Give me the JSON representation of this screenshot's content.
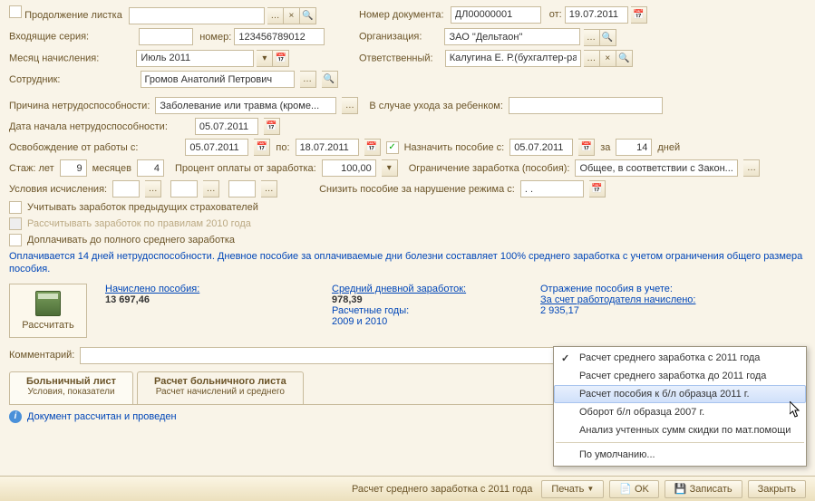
{
  "row1": {
    "cont_label": "Продолжение листка",
    "cont_value": "",
    "doc_num_label": "Номер документа:",
    "doc_num": "ДЛ00000001",
    "from_label": "от:",
    "from_date": "19.07.2011"
  },
  "row2": {
    "series_label": "Входящие серия:",
    "series": "",
    "num_label": "номер:",
    "num": "123456789012",
    "org_label": "Организация:",
    "org": "ЗАО \"Дельтаон\""
  },
  "row3": {
    "month_label": "Месяц начисления:",
    "month": "Июль 2011",
    "resp_label": "Ответственный:",
    "resp": "Калугина Е. Р.(бухгалтер-рас..."
  },
  "row4": {
    "emp_label": "Сотрудник:",
    "emp": "Громов Анатолий Петрович"
  },
  "reason": {
    "label": "Причина нетрудоспособности:",
    "value": "Заболевание или травма (кроме...",
    "child_label": "В случае ухода за ребенком:",
    "child_value": ""
  },
  "start": {
    "label": "Дата начала нетрудоcпособности:",
    "value": "05.07.2011"
  },
  "release": {
    "label": "Освобождение от работы с:",
    "from": "05.07.2011",
    "to_label": "по:",
    "to": "18.07.2011",
    "assign_label": "Назначить пособие с:",
    "assign": "05.07.2011",
    "for_label": "за",
    "days": "14",
    "days_label": "дней"
  },
  "stazh": {
    "label": "Стаж: лет",
    "years": "9",
    "months_label": "месяцев",
    "months": "4",
    "percent_label": "Процент оплаты от заработка:",
    "percent": "100,00",
    "limit_label": "Ограничение заработка (пособия):",
    "limit": "Общее, в соответствии с Закон..."
  },
  "conditions": {
    "label": "Условия исчисления:",
    "reduce_label": "Снизить пособие за нарушение режима с:",
    "reduce_date": ". ."
  },
  "chk1": "Учитывать заработок предыдущих страхователей",
  "chk2": "Рассчитывать заработок по правилам 2010 года",
  "chk3": "Доплачивать до полного среднего заработка",
  "info_text": "Оплачивается 14 дней нетрудоспособности. Дневное пособие за оплачиваемые дни болезни составляет 100% среднего заработка с учетом ограничения общего размера пособия.",
  "calc": {
    "btn": "Рассчитать",
    "accrued_label": "Начислено пособия:",
    "accrued": "13 697,46",
    "avg_label": "Средний дневной заработок:",
    "avg": "978,39",
    "years_label": "Расчетные годы:",
    "years": "2009 и 2010",
    "refl_label": "Отражение пособия в учете:",
    "employer_label": "За счет работодателя начислено:",
    "employer_val": "2 935,17"
  },
  "comment": {
    "label": "Комментарий:",
    "value": ""
  },
  "tabs": {
    "t1_title": "Больничный лист",
    "t1_sub": "Условия, показатели",
    "t2_title": "Расчет больничного листа",
    "t2_sub": "Расчет начислений и среднего"
  },
  "status": "Документ рассчитан и проведен",
  "popup": {
    "i1": "Расчет среднего заработка с 2011 года",
    "i2": "Расчет среднего заработка до 2011 года",
    "i3": "Расчет пособия к б/л образца 2011 г.",
    "i4": "Оборот б/л образца 2007 г.",
    "i5": "Анализ учтенных сумм скидки по мат.помощи",
    "i6": "По умолчанию..."
  },
  "footer": {
    "label": "Расчет среднего заработка с 2011 года",
    "print": "Печать",
    "ok": "OK",
    "save": "Записать",
    "close": "Закрыть"
  }
}
